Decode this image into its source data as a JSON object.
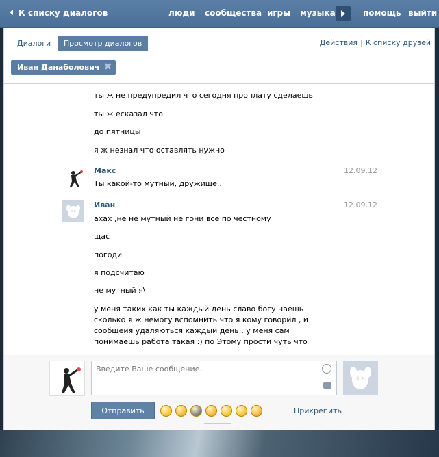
{
  "topbar": {
    "back_label": "К списку диалогов",
    "nav": [
      "люди",
      "сообщества",
      "игры",
      "музыка",
      "помощь",
      "выйти"
    ]
  },
  "tabs": {
    "dialogs": "Диалоги",
    "view_dialogs": "Просмотр диалогов",
    "actions": "Действия",
    "friends": "К списку друзей",
    "separator": "|"
  },
  "chip": {
    "name": "Иван Данаболович",
    "close": "✖"
  },
  "messages": {
    "group1": [
      "ты ж не предупредил что сегодня проплату сделаешь",
      "ты ж есказал что",
      "до пятницы",
      "я ж незнал что оставлять нужно"
    ],
    "maks": {
      "author": "Макс",
      "date": "12.09.12",
      "text": "Ты какой-то мутный, дружище.."
    },
    "ivan": {
      "author": "Иван",
      "date": "12.09.12",
      "lines": [
        "ахах ,не не мутный не гони все по честному",
        "щас",
        "погоди",
        "я подсчитаю",
        "не мутный я\\",
        "у меня таких как ты каждый день славо богу наешь сколько я ж немогу вспомнить что я кому говорил , и сообщеия удаляються каждый день , у меня сам понимаешь работа такая :) по Этому прости чуть что"
      ]
    }
  },
  "composer": {
    "placeholder": "Введите Ваше сообщение..",
    "send_label": "Отправить",
    "attach_label": "Прикрепить",
    "emoji_colors": [
      "#f7c02b",
      "#f7b12b",
      "#777777",
      "#f7b12b",
      "#f7c02b",
      "#f7c02b",
      "#f7b12b"
    ]
  }
}
